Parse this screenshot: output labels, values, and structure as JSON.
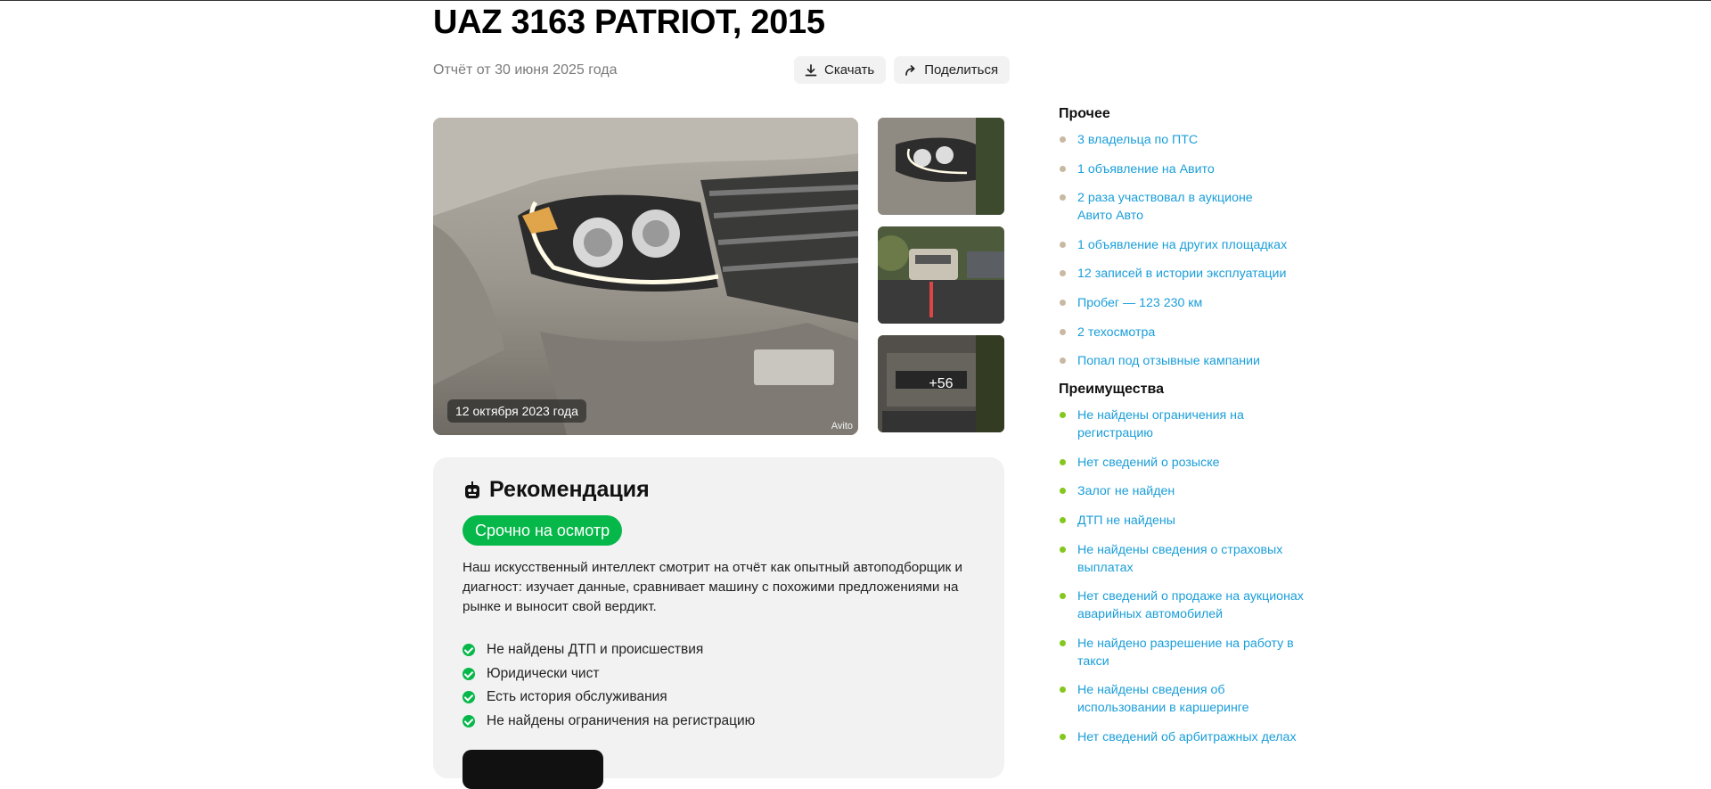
{
  "header": {
    "title": "UAZ 3163 PATRIOT, 2015",
    "report_date": "Отчёт от 30 июня 2025 года",
    "download_label": "Скачать",
    "share_label": "Поделиться"
  },
  "gallery": {
    "main_date": "12 октября 2023 года",
    "watermark": "Avito",
    "more_count": "+56"
  },
  "recommendation": {
    "title": "Рекомендация",
    "badge": "Срочно на осмотр",
    "description": "Наш искусственный интеллект смотрит на отчёт как опытный автоподборщик и диагност: изучает данные, сравнивает машину с похожими предложениями на рынке и выносит свой вердикт.",
    "checks": [
      "Не найдены ДТП и происшествия",
      "Юридически чист",
      "Есть история обслуживания",
      "Не найдены ограничения на регистрацию"
    ]
  },
  "sidebar": {
    "other": {
      "title": "Прочее",
      "color": "#c9b9a3",
      "items": [
        "3 владельца по ПТС",
        "1 объявление на Авито",
        "2 раза участвовал в аукционе Авито Авто",
        "1 объявление на других площадках",
        "12 записей в истории эксплуатации",
        "Пробег — 123 230 км",
        "2 техосмотра",
        "Попал под отзывные кампании"
      ]
    },
    "advantages": {
      "title": "Преимущества",
      "color": "#84c71d",
      "items": [
        "Не найдены ограничения на регистрацию",
        "Нет сведений о розыске",
        "Залог не найден",
        "ДТП не найдены",
        "Не найдены сведения о страховых выплатах",
        "Нет сведений о продаже на аукционах аварийных автомобилей",
        "Не найдено разрешение на работу в такси",
        "Не найдены сведения об использовании в каршеринге",
        "Нет сведений об арбитражных делах"
      ]
    }
  },
  "colors": {
    "link": "#1a9ed9",
    "accent_green": "#06b849"
  }
}
